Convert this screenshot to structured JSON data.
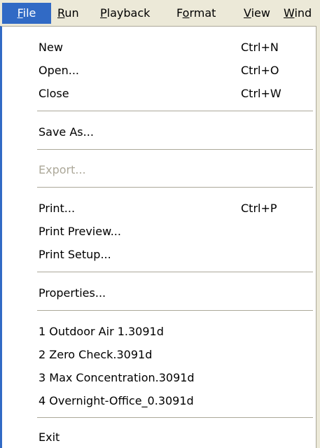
{
  "menubar": {
    "items": [
      {
        "label": "File",
        "accel": "F",
        "rest": "ile"
      },
      {
        "label": "Run",
        "accel": "R",
        "rest": "un"
      },
      {
        "label": "Playback",
        "accel": "P",
        "rest": "layback"
      },
      {
        "label": "Format",
        "pre": "F",
        "accel": "o",
        "rest": "rmat"
      },
      {
        "label": "View",
        "accel": "V",
        "rest": "iew"
      },
      {
        "label": "Window",
        "accel": "W",
        "rest": "ind"
      }
    ]
  },
  "file_menu": {
    "new": {
      "label": "New",
      "shortcut": "Ctrl+N"
    },
    "open": {
      "label": "Open...",
      "shortcut": "Ctrl+O"
    },
    "close": {
      "label": "Close",
      "shortcut": "Ctrl+W"
    },
    "save_as": {
      "label": "Save As..."
    },
    "export": {
      "label": "Export..."
    },
    "print": {
      "label": "Print...",
      "shortcut": "Ctrl+P"
    },
    "print_preview": {
      "label": "Print Preview..."
    },
    "print_setup": {
      "label": "Print Setup..."
    },
    "properties": {
      "label": "Properties..."
    },
    "recent": [
      {
        "label": "1 Outdoor Air 1.3091d"
      },
      {
        "label": "2 Zero Check.3091d"
      },
      {
        "label": "3 Max Concentration.3091d"
      },
      {
        "label": "4 Overnight-Office_0.3091d"
      }
    ],
    "exit": {
      "label": "Exit"
    }
  }
}
